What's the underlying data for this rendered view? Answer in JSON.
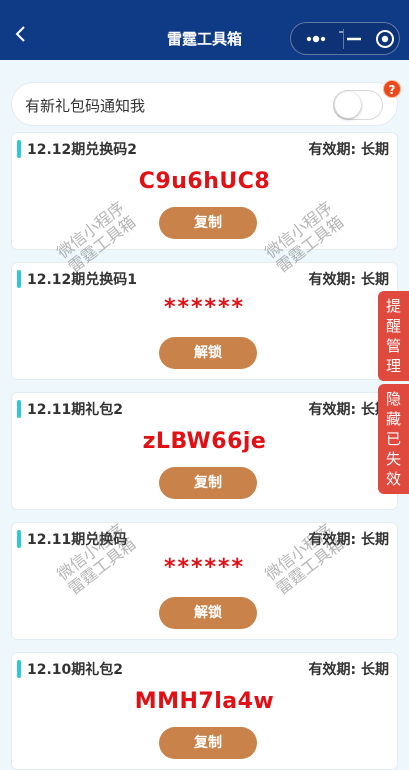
{
  "navbar": {
    "title": "雷霆工具箱",
    "back_icon": "chevron-left-icon",
    "more_icon": "more-dots-icon",
    "minimize_icon": "minimize-icon",
    "close_icon": "target-icon",
    "bg_color": "#0f3a86"
  },
  "notify": {
    "label": "有新礼包码通知我",
    "toggle_on": false,
    "badge": "?"
  },
  "cards": [
    {
      "title": "12.12期兑换码2",
      "validity": "有效期: 长期",
      "code": "C9u6hUC8",
      "button": "复制"
    },
    {
      "title": "12.12期兑换码1",
      "validity": "有效期: 长期",
      "code": "******",
      "button": "解锁"
    },
    {
      "title": "12.11期礼包2",
      "validity": "有效期: 长期",
      "code": "zLBW66je",
      "button": "复制"
    },
    {
      "title": "12.11期兑换码",
      "validity": "有效期: 长期",
      "code": "******",
      "button": "解锁"
    },
    {
      "title": "12.10期礼包2",
      "validity": "有效期: 长期",
      "code": "MMH7la4w",
      "button": "复制"
    }
  ],
  "watermark": {
    "line1": "微信小程序",
    "line2": "雷霆工具箱"
  },
  "side_tabs": {
    "reminder": "提醒管理",
    "hide_expired": "隐藏已失效"
  },
  "colors": {
    "accent_bar": "#2fc9d6",
    "code_red": "#e20f14",
    "button_brown": "#c98249",
    "side_tab_red": "#e0493e"
  }
}
